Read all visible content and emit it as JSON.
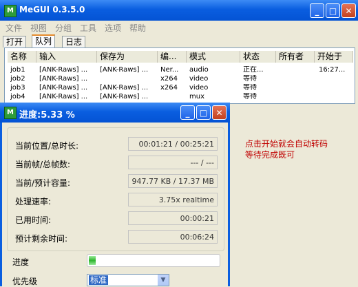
{
  "window": {
    "title": "MeGUI 0.3.5.0",
    "controls": {
      "minimize": "_",
      "maximize": "□",
      "close": "✕"
    }
  },
  "menu": [
    "文件",
    "视图",
    "分组",
    "工具",
    "选项",
    "帮助"
  ],
  "tabs": [
    "打开",
    "队列",
    "日志"
  ],
  "queue": {
    "columns": [
      "名称",
      "输入",
      "保存为",
      "编...",
      "模式",
      "状态",
      "所有者",
      "开始于"
    ],
    "rows": [
      [
        "job1",
        "[ANK-Raws] ...",
        "[ANK-Raws] ...",
        "Ner...",
        "audio",
        "正在...",
        "",
        "16:27..."
      ],
      [
        "job2",
        "[ANK-Raws] ...",
        "",
        "x264",
        "video",
        "等待",
        "",
        ""
      ],
      [
        "job3",
        "[ANK-Raws] ...",
        "[ANK-Raws] ...",
        "x264",
        "video",
        "等待",
        "",
        ""
      ],
      [
        "job4",
        "[ANK-Raws] ...",
        "[ANK-Raws] ...",
        "",
        "mux",
        "等待",
        "",
        ""
      ]
    ]
  },
  "progress_dialog": {
    "title": "进度:5.33 %",
    "fields": [
      {
        "label": "当前位置/总时长:",
        "value": "00:01:21 / 00:25:21"
      },
      {
        "label": "当前帧/总帧数:",
        "value": "--- / ---"
      },
      {
        "label": "当前/预计容量:",
        "value": "947.77 KB / 17.37 MB"
      },
      {
        "label": "处理速率:",
        "value": "3.75x realtime"
      },
      {
        "label": "已用时间:",
        "value": "00:00:21"
      },
      {
        "label": "预计剩余时间:",
        "value": "00:06:24"
      }
    ],
    "progress_label": "进度",
    "progress_percent": 5.33,
    "priority_label": "优先级",
    "priority_value": "标准"
  },
  "annotation": {
    "line1": "点击开始就会自动转码",
    "line2": "等待完成既可"
  }
}
